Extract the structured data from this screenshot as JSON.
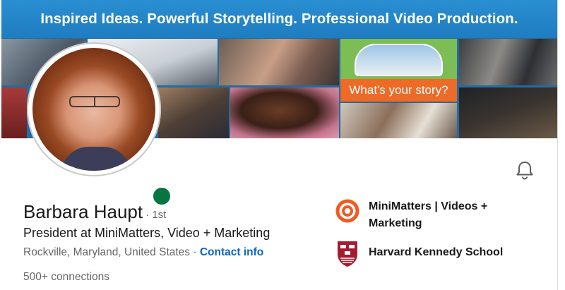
{
  "banner": {
    "tagline": "Inspired Ideas. Powerful Storytelling. Professional Video Production.",
    "story_text": "What's your story?"
  },
  "profile": {
    "name": "Barbara Haupt",
    "connection_degree": "· 1st",
    "headline": "President at MiniMatters, Video + Marketing",
    "location": "Rockville, Maryland, United States ·",
    "contact_link": "Contact info",
    "connections": "500+ connections",
    "status": "online"
  },
  "organizations": [
    {
      "name": "MiniMatters | Videos + Marketing",
      "logo": "minimatters-logo"
    },
    {
      "name": "Harvard Kennedy School",
      "logo": "harvard-shield-logo"
    }
  ],
  "colors": {
    "banner_blue": "#1f7cc0",
    "link_blue": "#0a66c2",
    "online_green": "#057642",
    "story_orange": "#ee6a27",
    "harvard_crimson": "#a51c30",
    "minimatters_orange": "#f15a22"
  },
  "icons": {
    "notification": "bell-icon"
  }
}
